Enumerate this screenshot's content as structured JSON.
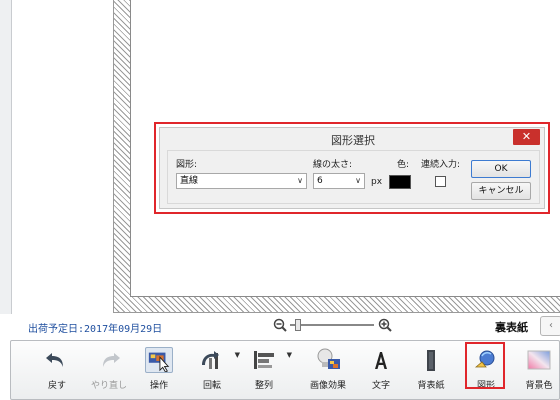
{
  "dialog": {
    "title": "図形選択",
    "close_label": "✕",
    "shape_label": "図形:",
    "shape_value": "直線",
    "width_label": "線の太さ:",
    "width_value": "6",
    "width_unit": "px",
    "color_label": "色:",
    "color_value": "#000000",
    "continuous_label": "連続入力:",
    "continuous_checked": false,
    "ok_label": "OK",
    "cancel_label": "キャンセル"
  },
  "status": {
    "ship_date": "出荷予定日:2017年09月29日",
    "zoom_level": 0.1,
    "page_side": "裏表紙",
    "prev_icon": "chevron-left-icon"
  },
  "toolbar": {
    "items": [
      {
        "label": "戻す",
        "icon": "undo-icon"
      },
      {
        "label": "やり直し",
        "icon": "redo-icon"
      },
      {
        "label": "操作",
        "icon": "select-cursor-icon"
      },
      {
        "label": "回転",
        "icon": "rotate-icon"
      },
      {
        "label": "整列",
        "icon": "align-icon"
      },
      {
        "label": "画像効果",
        "icon": "image-effect-icon"
      },
      {
        "label": "文字",
        "icon": "text-icon"
      },
      {
        "label": "背表紙",
        "icon": "spine-icon"
      },
      {
        "label": "図形",
        "icon": "shape-icon"
      },
      {
        "label": "背景色",
        "icon": "background-color-icon"
      }
    ]
  },
  "colors": {
    "highlight": "#e0262b",
    "date_text": "#1f4f9f",
    "close_button": "#c9302c"
  }
}
